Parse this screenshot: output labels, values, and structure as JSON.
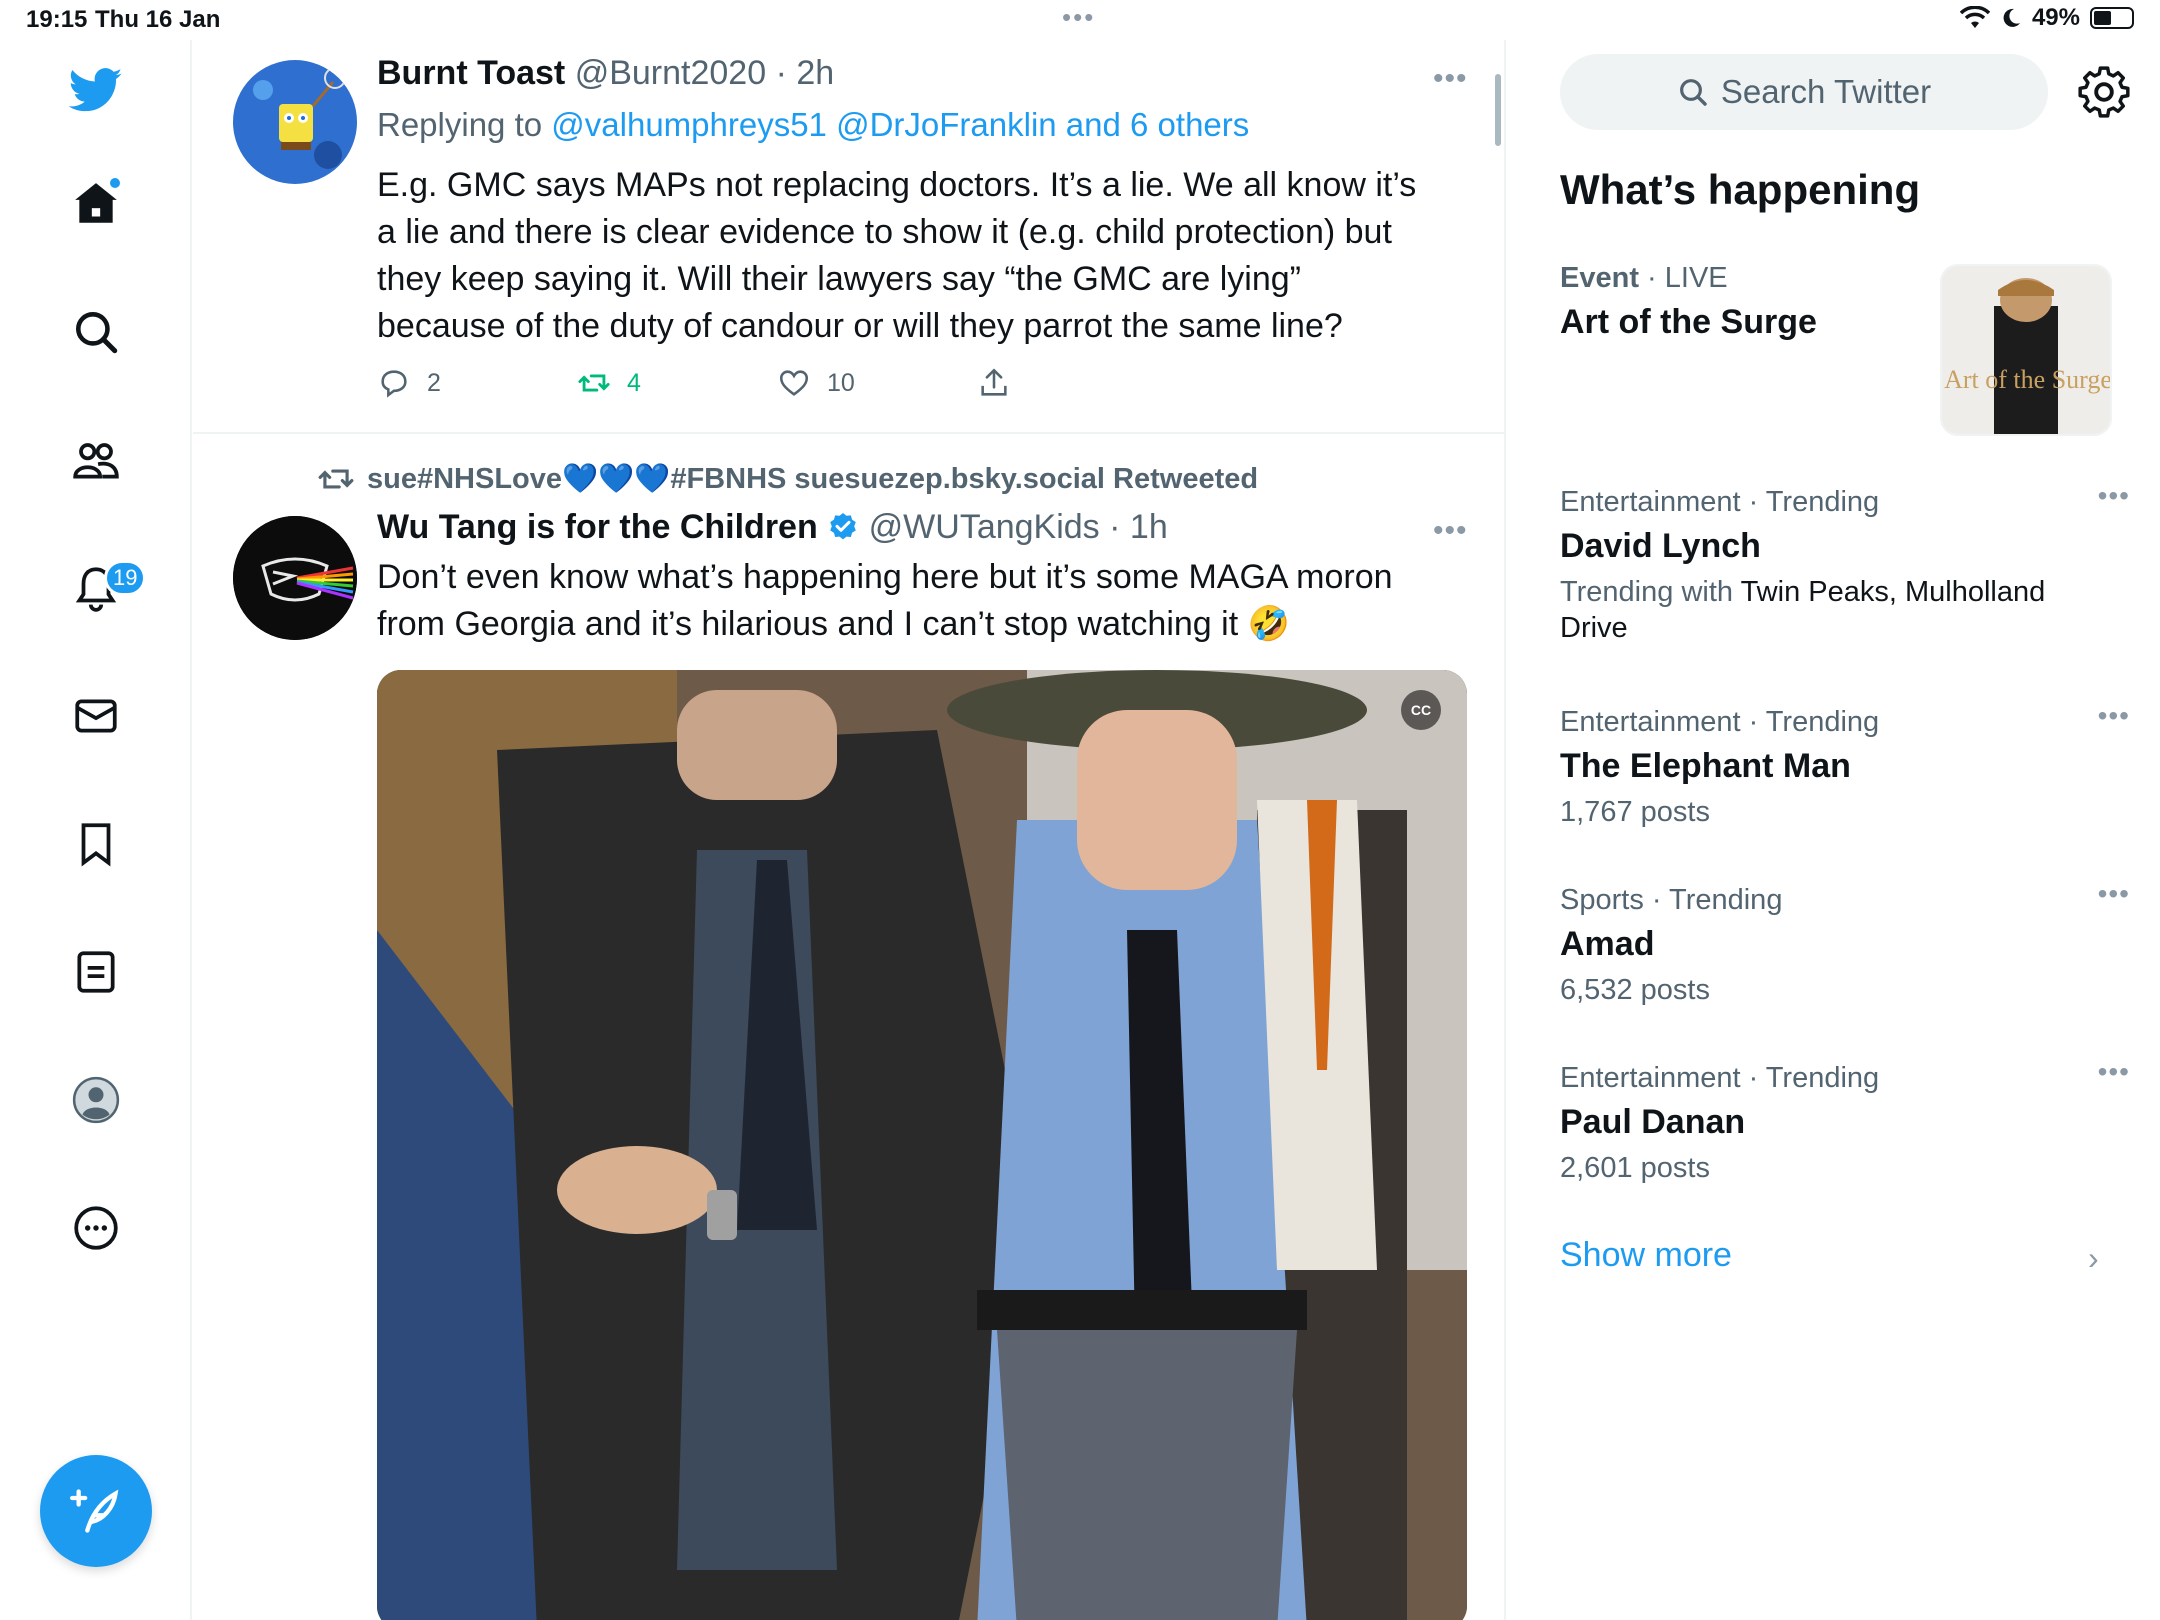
{
  "status": {
    "time": "19:15",
    "date": "Thu 16 Jan",
    "battery": "49%"
  },
  "nav": {
    "notifications_badge": "19"
  },
  "tweets": [
    {
      "name": "Burnt Toast",
      "handle": "@Burnt2020",
      "time": "2h",
      "replying_prefix": "Replying to",
      "replying_links": "@valhumphreys51 @DrJoFranklin and 6 others",
      "text": "E.g. GMC says MAPs not replacing doctors. It’s a lie. We all know it’s a lie and there is clear evidence to show it (e.g. child protection) but they keep saying it. Will their lawyers say “the GMC are lying” because of the duty of candour or will they parrot the same line?",
      "replies": "2",
      "retweets": "4",
      "likes": "10"
    },
    {
      "retweeted_by": "sue#NHSLove💙💙💙#FBNHS suesuezep.bsky.social Retweeted",
      "name": "Wu Tang is for the Children",
      "handle": "@WUTangKids",
      "time": "1h",
      "text": "Don’t even know what’s happening here but it’s some MAGA moron from Georgia and it’s hilarious and I can’t stop watching it 🤣",
      "media_cc": "CC"
    }
  ],
  "sidebar": {
    "search_placeholder": "Search Twitter",
    "section_title": "What’s happening",
    "event": {
      "category": "Event",
      "live": "LIVE",
      "title": "Art of the Surge",
      "thumb_text": "Art of the Surge"
    },
    "trends": [
      {
        "category": "Entertainment · Trending",
        "title": "David Lynch",
        "sub_prefix": "Trending with",
        "sub_links": "Twin Peaks, Mulholland Drive"
      },
      {
        "category": "Entertainment · Trending",
        "title": "The Elephant Man",
        "count": "1,767 posts"
      },
      {
        "category": "Sports · Trending",
        "title": "Amad",
        "count": "6,532 posts"
      },
      {
        "category": "Entertainment · Trending",
        "title": "Paul Danan",
        "count": "2,601 posts"
      }
    ],
    "show_more": "Show more"
  },
  "colors": {
    "accent": "#1d9bf0",
    "retweet_green": "#00ba7c",
    "secondary_text": "#536471"
  }
}
